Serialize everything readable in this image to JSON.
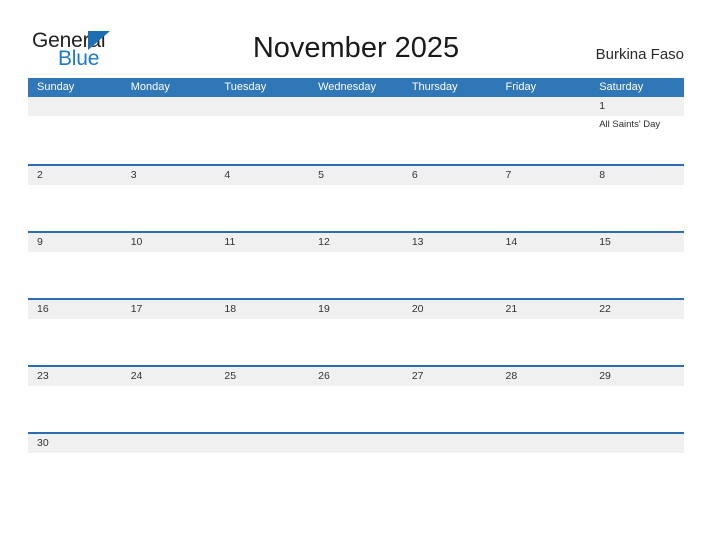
{
  "branding": {
    "logo_line1": "General",
    "logo_line2": "Blue",
    "logo_triangle_icon": "triangle-icon",
    "primary_color": "#3077b8",
    "accent_color": "#1c7ad1",
    "rule_color": "#2a6eaf",
    "band_color": "#f0f0f0"
  },
  "header": {
    "title": "November 2025",
    "country": "Burkina Faso"
  },
  "calendar": {
    "weekdays": [
      "Sunday",
      "Monday",
      "Tuesday",
      "Wednesday",
      "Thursday",
      "Friday",
      "Saturday"
    ],
    "weeks": [
      [
        {
          "day": "",
          "events": []
        },
        {
          "day": "",
          "events": []
        },
        {
          "day": "",
          "events": []
        },
        {
          "day": "",
          "events": []
        },
        {
          "day": "",
          "events": []
        },
        {
          "day": "",
          "events": []
        },
        {
          "day": "1",
          "events": [
            "All Saints' Day"
          ]
        }
      ],
      [
        {
          "day": "2",
          "events": []
        },
        {
          "day": "3",
          "events": []
        },
        {
          "day": "4",
          "events": []
        },
        {
          "day": "5",
          "events": []
        },
        {
          "day": "6",
          "events": []
        },
        {
          "day": "7",
          "events": []
        },
        {
          "day": "8",
          "events": []
        }
      ],
      [
        {
          "day": "9",
          "events": []
        },
        {
          "day": "10",
          "events": []
        },
        {
          "day": "11",
          "events": []
        },
        {
          "day": "12",
          "events": []
        },
        {
          "day": "13",
          "events": []
        },
        {
          "day": "14",
          "events": []
        },
        {
          "day": "15",
          "events": []
        }
      ],
      [
        {
          "day": "16",
          "events": []
        },
        {
          "day": "17",
          "events": []
        },
        {
          "day": "18",
          "events": []
        },
        {
          "day": "19",
          "events": []
        },
        {
          "day": "20",
          "events": []
        },
        {
          "day": "21",
          "events": []
        },
        {
          "day": "22",
          "events": []
        }
      ],
      [
        {
          "day": "23",
          "events": []
        },
        {
          "day": "24",
          "events": []
        },
        {
          "day": "25",
          "events": []
        },
        {
          "day": "26",
          "events": []
        },
        {
          "day": "27",
          "events": []
        },
        {
          "day": "28",
          "events": []
        },
        {
          "day": "29",
          "events": []
        }
      ],
      [
        {
          "day": "30",
          "events": []
        },
        {
          "day": "",
          "events": []
        },
        {
          "day": "",
          "events": []
        },
        {
          "day": "",
          "events": []
        },
        {
          "day": "",
          "events": []
        },
        {
          "day": "",
          "events": []
        },
        {
          "day": "",
          "events": []
        }
      ]
    ]
  }
}
